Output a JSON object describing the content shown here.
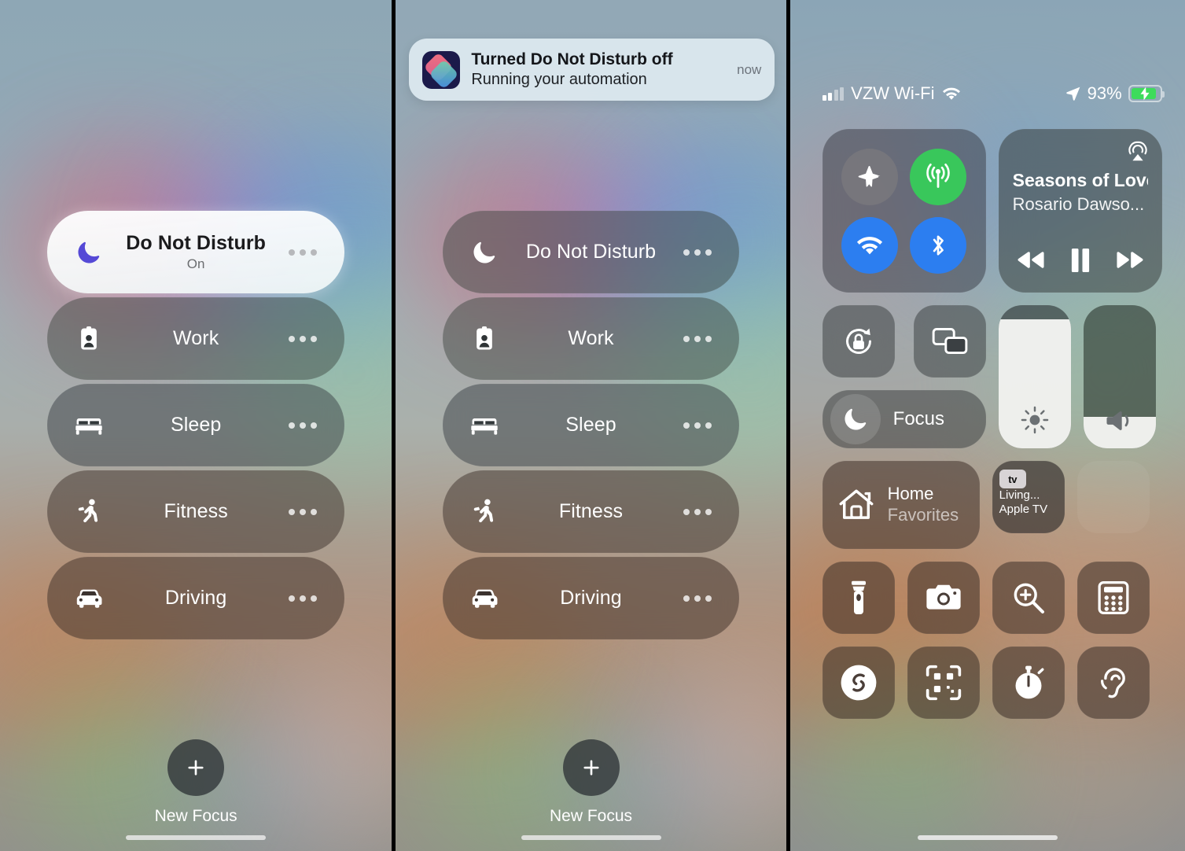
{
  "panels": {
    "panel1": {
      "name": "Focus control center - Do Not Disturb On",
      "focus_items": [
        {
          "label": "Do Not Disturb",
          "sublabel": "On",
          "icon": "moon-icon",
          "active": true
        },
        {
          "label": "Work",
          "sublabel": "",
          "icon": "id-badge-icon",
          "active": false
        },
        {
          "label": "Sleep",
          "sublabel": "",
          "icon": "bed-icon",
          "active": false
        },
        {
          "label": "Fitness",
          "sublabel": "",
          "icon": "running-person-icon",
          "active": false
        },
        {
          "label": "Driving",
          "sublabel": "",
          "icon": "car-icon",
          "active": false
        }
      ],
      "new_focus_label": "New Focus"
    },
    "panel2": {
      "name": "Focus control center - Do Not Disturb Off with notification",
      "notification": {
        "app_icon": "shortcuts-icon",
        "title": "Turned Do Not Disturb off",
        "subtitle": "Running your automation",
        "time": "now"
      },
      "focus_items": [
        {
          "label": "Do Not Disturb",
          "sublabel": "",
          "icon": "moon-icon",
          "active": false
        },
        {
          "label": "Work",
          "sublabel": "",
          "icon": "id-badge-icon",
          "active": false
        },
        {
          "label": "Sleep",
          "sublabel": "",
          "icon": "bed-icon",
          "active": false
        },
        {
          "label": "Fitness",
          "sublabel": "",
          "icon": "running-person-icon",
          "active": false
        },
        {
          "label": "Driving",
          "sublabel": "",
          "icon": "car-icon",
          "active": false
        }
      ],
      "new_focus_label": "New Focus"
    },
    "panel3": {
      "name": "iOS Control Center",
      "status_bar": {
        "carrier": "VZW Wi-Fi",
        "signal_bars_filled": 2,
        "signal_bars_total": 4,
        "wifi_icon": "wifi-icon",
        "location_icon": "location-arrow-icon",
        "battery_percent": "93%",
        "battery_level": 93,
        "battery_charging": true,
        "battery_color": "#3ddc5b"
      },
      "connectivity": {
        "airplane": {
          "name": "Airplane Mode",
          "icon": "airplane-icon",
          "state": "off",
          "color": "#7e7c80"
        },
        "cellular": {
          "name": "Cellular Data",
          "icon": "cellular-icon",
          "state": "on",
          "color": "#39c75b"
        },
        "wifi": {
          "name": "Wi-Fi",
          "icon": "wifi-icon",
          "state": "on",
          "color": "#2c7ef0"
        },
        "bluetooth": {
          "name": "Bluetooth",
          "icon": "bluetooth-icon",
          "state": "on",
          "color": "#2c7ef0"
        }
      },
      "media": {
        "title": "Seasons of Love",
        "artist": "Rosario Dawso...",
        "airplay_icon": "airplay-icon",
        "rewind_icon": "rewind-icon",
        "playpause_icon": "pause-icon",
        "forward_icon": "fast-forward-icon",
        "playing": true
      },
      "rotation_lock": {
        "name": "Rotation Lock",
        "icon": "rotation-lock-icon"
      },
      "screen_mirroring": {
        "name": "Screen Mirroring",
        "icon": "screen-mirroring-icon"
      },
      "focus": {
        "label": "Focus",
        "icon": "moon-icon"
      },
      "brightness": {
        "name": "Brightness",
        "icon": "brightness-icon",
        "value": 90
      },
      "volume": {
        "name": "Volume",
        "icon": "speaker-icon",
        "value": 22
      },
      "home": {
        "title": "Home",
        "subtitle": "Favorites",
        "icon": "home-icon"
      },
      "appletv": {
        "badge": "tv",
        "line1": "Living...",
        "line2": "Apple TV"
      },
      "utilities_row1": [
        {
          "name": "Flashlight",
          "icon": "flashlight-icon"
        },
        {
          "name": "Camera",
          "icon": "camera-icon"
        },
        {
          "name": "Magnifier",
          "icon": "magnifier-icon"
        },
        {
          "name": "Calculator",
          "icon": "calculator-icon"
        }
      ],
      "utilities_row2": [
        {
          "name": "Shazam",
          "icon": "shazam-icon"
        },
        {
          "name": "Code Scanner",
          "icon": "qr-code-icon"
        },
        {
          "name": "Timer",
          "icon": "timer-icon"
        },
        {
          "name": "Hearing",
          "icon": "hearing-icon"
        }
      ]
    }
  }
}
